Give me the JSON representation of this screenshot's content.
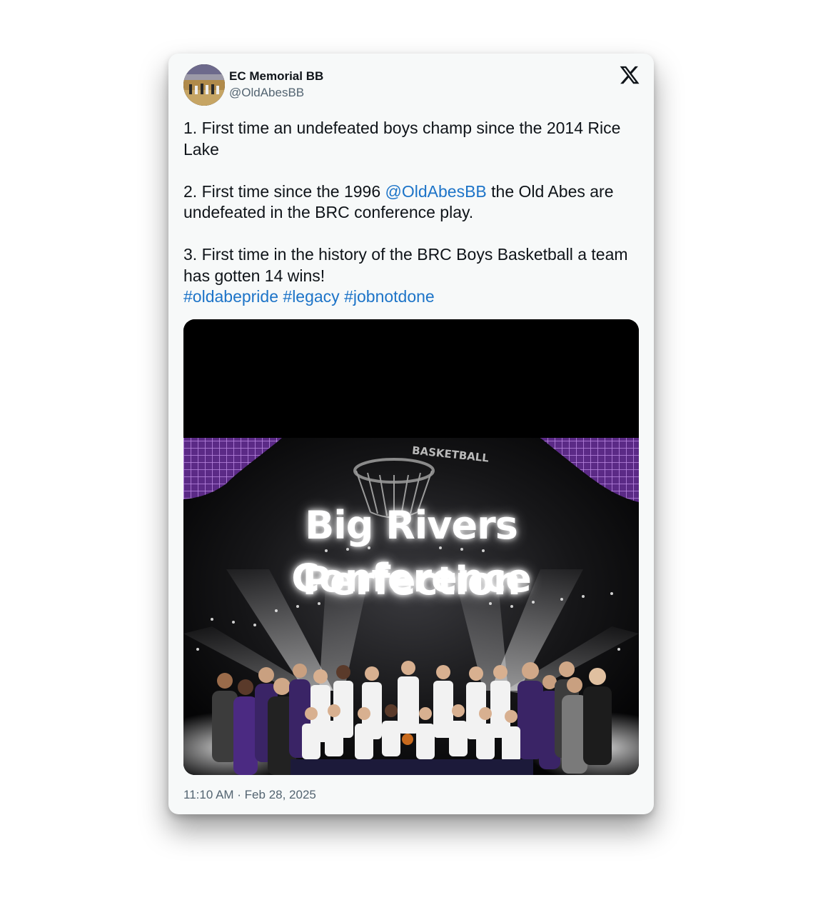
{
  "tweet": {
    "display_name": "EC Memorial BB",
    "handle": "@OldAbesBB",
    "paragraphs": [
      {
        "text": "1. First time an undefeated boys champ since the 2014 Rice Lake"
      },
      {
        "before": "2. First time since the 1996 ",
        "mention": "@OldAbesBB",
        "after": " the Old Abes are undefeated in the BRC conference play."
      },
      {
        "text": "3. First time in the history of the BRC Boys Basketball a team has gotten 14 wins!"
      }
    ],
    "hashtags": [
      "#oldabepride",
      "#legacy",
      "#jobnotdone"
    ],
    "timestamp": "11:10 AM · Feb 28, 2025"
  },
  "media": {
    "overlay_line1": "Big Rivers Conference",
    "overlay_line2": "Perfection",
    "court_label": "BASKETBALL"
  },
  "icons": {
    "logo": "x-logo-icon",
    "avatar": "team-photo-avatar"
  },
  "colors": {
    "link": "#1d74c8",
    "text": "#0f1419",
    "muted": "#536471",
    "card_bg": "#f7f9f9",
    "purple": "#6a2ea0"
  }
}
